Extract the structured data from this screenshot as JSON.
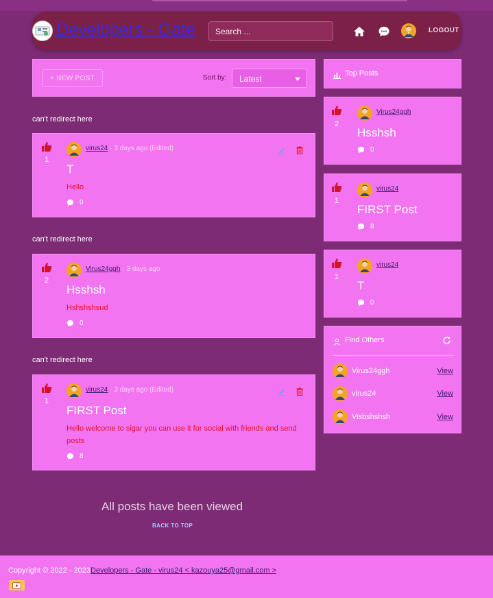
{
  "header": {
    "brand": "Developers - Gate",
    "search_placeholder": "Search ...",
    "logout_label": "LOGOUT"
  },
  "toolbar": {
    "new_post_label": "+ NEW POST",
    "sort_label": "Sort by:",
    "sort_value": "Latest"
  },
  "feed": {
    "notice": "can't redirect here",
    "posts": [
      {
        "votes": "1",
        "user": "virus24",
        "meta": "· 3 days ago (Edited)",
        "title": "T",
        "body": "Hello",
        "comments": "0"
      },
      {
        "votes": "2",
        "user": "Virus24ggh",
        "meta": "· 3 days ago",
        "title": "Hsshsh",
        "body": "Hshshshsud",
        "comments": "0"
      },
      {
        "votes": "1",
        "user": "virus24",
        "meta": "· 3 days ago (Edited)",
        "title": "FIRST Post",
        "body": "Hello welcome to sigar you can use it for social with friends and send posts",
        "comments": "8"
      }
    ],
    "end_message": "All posts have been viewed",
    "back_to_top": "BACK TO TOP"
  },
  "sidebar": {
    "top_posts_title": "Top Posts",
    "top_posts": [
      {
        "votes": "2",
        "user": "Virus24ggh",
        "title": "Hsshsh",
        "comments": "0"
      },
      {
        "votes": "1",
        "user": "virus24",
        "title": "FIRST Post",
        "comments": "8"
      },
      {
        "votes": "1",
        "user": "virus24",
        "title": "T",
        "comments": "0"
      }
    ],
    "find_others_title": "Find Others",
    "users": [
      {
        "name": "Virus24ggh",
        "action": "View"
      },
      {
        "name": "virus24",
        "action": "View"
      },
      {
        "name": "Visbshshsh",
        "action": "View"
      }
    ]
  },
  "footer": {
    "copyright": "Copyright © 2022 - 2023",
    "link": "Developers - Gate - virus24 < kazouya25@gmail.com >"
  },
  "colors": {
    "background": "#7d2b75",
    "card": "#f374f0",
    "header": "#7b2046",
    "accent_red": "#e8102a",
    "avatar": "#f4a423"
  }
}
